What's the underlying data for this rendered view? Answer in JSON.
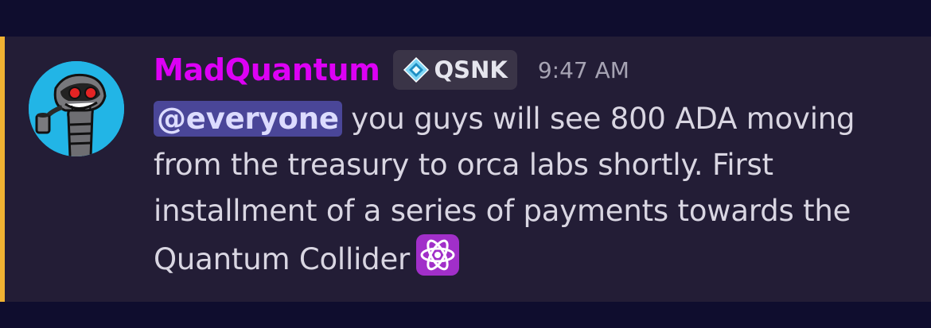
{
  "message": {
    "author": "MadQuantum",
    "role_tag": "QSNK",
    "role_tag_icon": "diamond-crystal-icon",
    "timestamp": "9:47 AM",
    "mention": "@everyone",
    "body": " you guys will see 800 ADA moving from the treasury to orca labs shortly. First installment of a series of payments towards the Quantum Collider",
    "emoji": "atom-symbol-icon"
  },
  "colors": {
    "background": "#0f0d2e",
    "message_background": "#231d36",
    "accent_bar": "#f0b232",
    "username": "#dd00f5",
    "mention_background": "#4a4698",
    "avatar_background": "#22b5e6",
    "emoji_background": "#a12fc9"
  }
}
